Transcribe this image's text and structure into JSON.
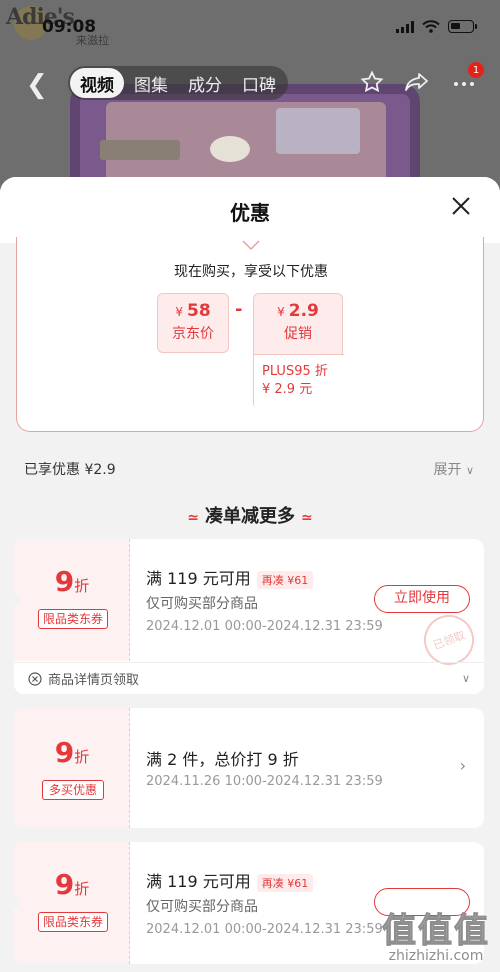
{
  "status_bar": {
    "time": "09:08"
  },
  "brand": {
    "logo_text": "Adie's",
    "logo_sub": "来滋拉"
  },
  "nav": {
    "tabs": [
      {
        "label": "视频",
        "active": true
      },
      {
        "label": "图集",
        "active": false
      },
      {
        "label": "成分",
        "active": false
      },
      {
        "label": "口碑",
        "active": false
      }
    ],
    "badge_count": "1"
  },
  "sheet": {
    "title": "优惠",
    "promo": {
      "headline": "现在购买，享受以下优惠",
      "price_currency": "¥",
      "jd_price": "58",
      "jd_price_label": "京东价",
      "minus": "-",
      "promo_price": "2.9",
      "promo_label": "促销",
      "plus_line1": "PLUS95 折",
      "plus_line2": "¥ 2.9 元"
    },
    "enjoyed": "已享优惠 ¥2.9",
    "expand": "展开",
    "more_title": "凑单减更多",
    "coupons": [
      {
        "rate": "9",
        "rate_unit": "折",
        "tag": "限品类东券",
        "title": "满 119 元可用",
        "extra_tag": "再凑 ¥61",
        "desc": "仅可购买部分商品",
        "period": "2024.12.01 00:00-2024.12.31 23:59",
        "button": "立即使用",
        "stamp": "已领取",
        "footer": "商品详情页领取"
      },
      {
        "rate": "9",
        "rate_unit": "折",
        "tag": "多买优惠",
        "title": "满 2 件，总价打 9 折",
        "period": "2024.11.26 10:00-2024.12.31 23:59"
      },
      {
        "rate": "9",
        "rate_unit": "折",
        "tag": "限品类东券",
        "title": "满 119 元可用",
        "extra_tag": "再凑 ¥61",
        "desc": "仅可购买部分商品",
        "period": "2024.12.01 00:00-2024.12.31 23:59"
      }
    ]
  },
  "watermark": {
    "big": "值值值",
    "small": "zhizhizhi.com"
  },
  "colors": {
    "accent": "#e4393c",
    "light_accent": "#fdeceb"
  }
}
